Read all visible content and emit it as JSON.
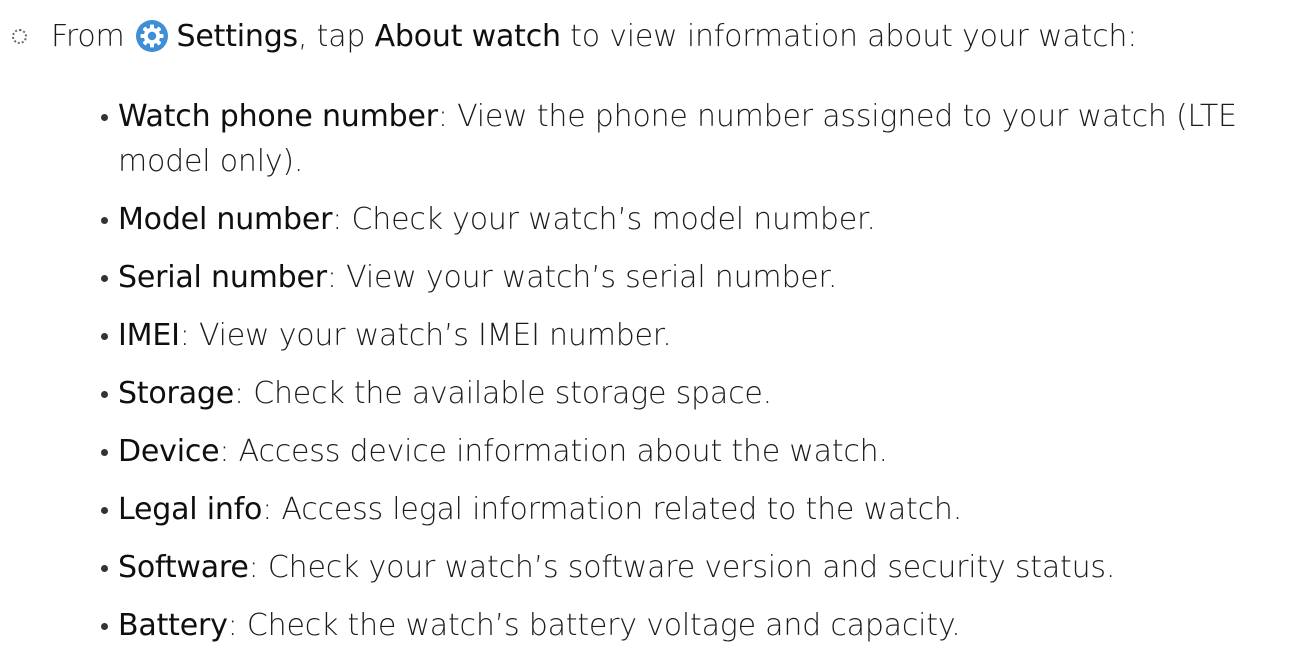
{
  "step": {
    "prefix": "From",
    "settings_label": "Settings",
    "middle": ", tap",
    "about_label": "About watch",
    "suffix": "to view information about your watch:",
    "icon": "settings-gear-icon",
    "icon_color": "#3e8fd5"
  },
  "items": [
    {
      "term": "Watch phone number",
      "desc": ": View the phone number assigned to your watch (LTE model only)."
    },
    {
      "term": "Model number",
      "desc": ": Check your watch’s model number."
    },
    {
      "term": "Serial number",
      "desc": ": View your watch’s serial number."
    },
    {
      "term": "IMEI",
      "desc": ": View your watch’s IMEI number."
    },
    {
      "term": "Storage",
      "desc": ": Check the available storage space."
    },
    {
      "term": "Device",
      "desc": ": Access device information about the watch."
    },
    {
      "term": "Legal info",
      "desc": ": Access legal information related to the watch."
    },
    {
      "term": "Software",
      "desc": ": Check your watch’s software version and security status."
    },
    {
      "term": "Battery",
      "desc": ": Check the watch’s battery voltage and capacity."
    }
  ]
}
